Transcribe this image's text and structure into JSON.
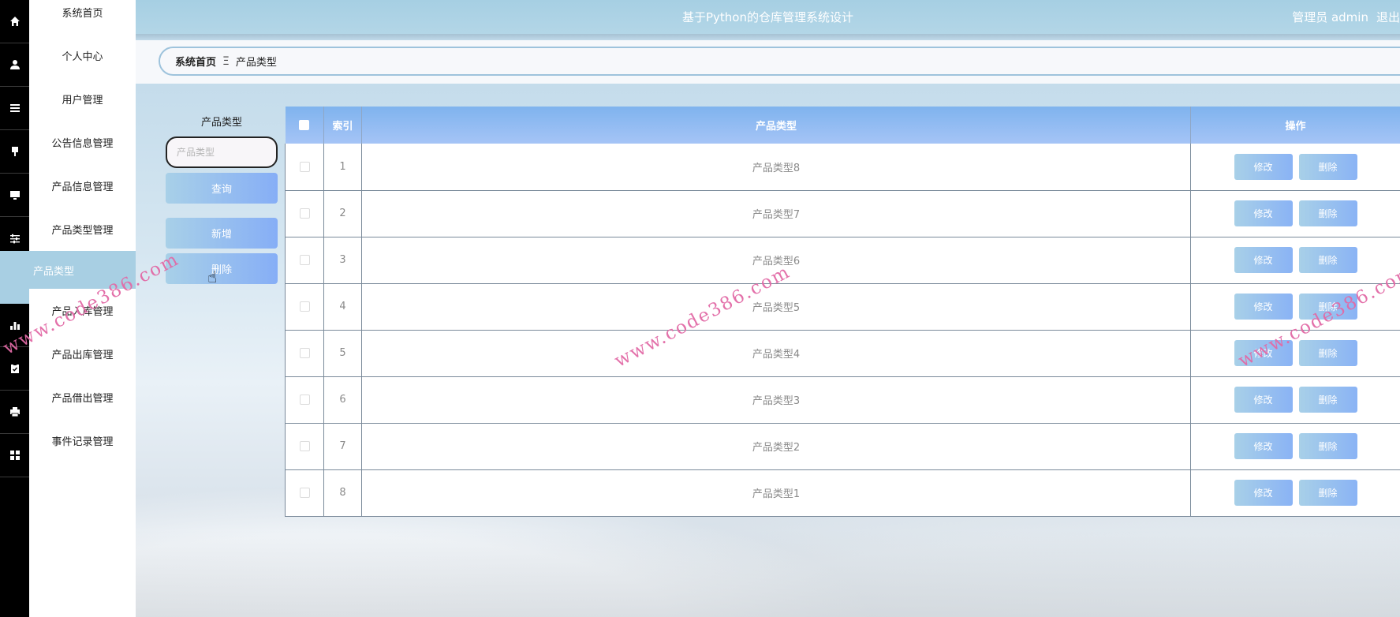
{
  "header": {
    "title": "基于Python的仓库管理系统设计",
    "user_label": "管理员 admin",
    "logout_label": "退出"
  },
  "rail": {
    "icons": [
      "home-icon",
      "user-icon",
      "list-icon",
      "pin-icon",
      "monitor-icon",
      "sliders-icon",
      "bar-chart-icon",
      "clipboard-icon",
      "printer-icon",
      "grid-icon"
    ]
  },
  "sidebar": {
    "items": [
      {
        "label": "系统首页"
      },
      {
        "label": "个人中心"
      },
      {
        "label": "用户管理"
      },
      {
        "label": "公告信息管理"
      },
      {
        "label": "产品信息管理"
      },
      {
        "label": "产品类型管理"
      },
      {
        "label": "产品类型"
      },
      {
        "label": "产品入库管理"
      },
      {
        "label": "产品出库管理"
      },
      {
        "label": "产品借出管理"
      },
      {
        "label": "事件记录管理"
      }
    ]
  },
  "breadcrumb": {
    "home": "系统首页",
    "separator": "Ξ",
    "current": "产品类型"
  },
  "search": {
    "label": "产品类型",
    "placeholder": "产品类型",
    "query_label": "查询",
    "add_label": "新增",
    "delete_label": "删除"
  },
  "table": {
    "headers": {
      "index": "索引",
      "type": "产品类型",
      "actions": "操作"
    },
    "edit_label": "修改",
    "delete_label": "删除",
    "rows": [
      {
        "index": "1",
        "type": "产品类型8"
      },
      {
        "index": "2",
        "type": "产品类型7"
      },
      {
        "index": "3",
        "type": "产品类型6"
      },
      {
        "index": "4",
        "type": "产品类型5"
      },
      {
        "index": "5",
        "type": "产品类型4"
      },
      {
        "index": "6",
        "type": "产品类型3"
      },
      {
        "index": "7",
        "type": "产品类型2"
      },
      {
        "index": "8",
        "type": "产品类型1"
      }
    ]
  },
  "watermark": "www.code386.com",
  "colors": {
    "header_bg": "#a6cfe3",
    "accent": "#86aef6",
    "watermark": "#e26aa6"
  }
}
